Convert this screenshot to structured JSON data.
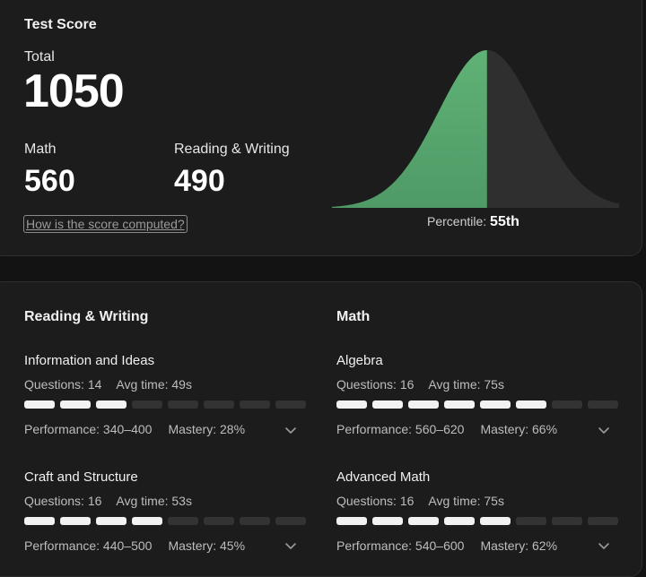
{
  "score": {
    "title": "Test Score",
    "total_label": "Total",
    "total_value": "1050",
    "math_label": "Math",
    "math_value": "560",
    "rw_label": "Reading & Writing",
    "rw_value": "490",
    "help_link": "How is the score computed?",
    "percentile_label": "Percentile:",
    "percentile_value": "55th",
    "percentile_fraction": 0.55,
    "colors": {
      "fill": "#4f9a66",
      "fill_top": "#5fb276",
      "rest": "#2f2f2f"
    }
  },
  "sections": [
    {
      "title": "Reading & Writing",
      "categories": [
        {
          "name": "Information and Ideas",
          "questions": "Questions: 14",
          "avg_time": "Avg time: 49s",
          "filled": 3,
          "total": 8,
          "performance": "Performance: 340–400",
          "mastery": "Mastery: 28%"
        },
        {
          "name": "Craft and Structure",
          "questions": "Questions: 16",
          "avg_time": "Avg time: 53s",
          "filled": 4,
          "total": 8,
          "performance": "Performance: 440–500",
          "mastery": "Mastery: 45%"
        }
      ]
    },
    {
      "title": "Math",
      "categories": [
        {
          "name": "Algebra",
          "questions": "Questions: 16",
          "avg_time": "Avg time: 75s",
          "filled": 6,
          "total": 8,
          "performance": "Performance: 560–620",
          "mastery": "Mastery: 66%"
        },
        {
          "name": "Advanced Math",
          "questions": "Questions: 16",
          "avg_time": "Avg time: 75s",
          "filled": 5,
          "total": 8,
          "performance": "Performance: 540–600",
          "mastery": "Mastery: 62%"
        }
      ]
    }
  ]
}
